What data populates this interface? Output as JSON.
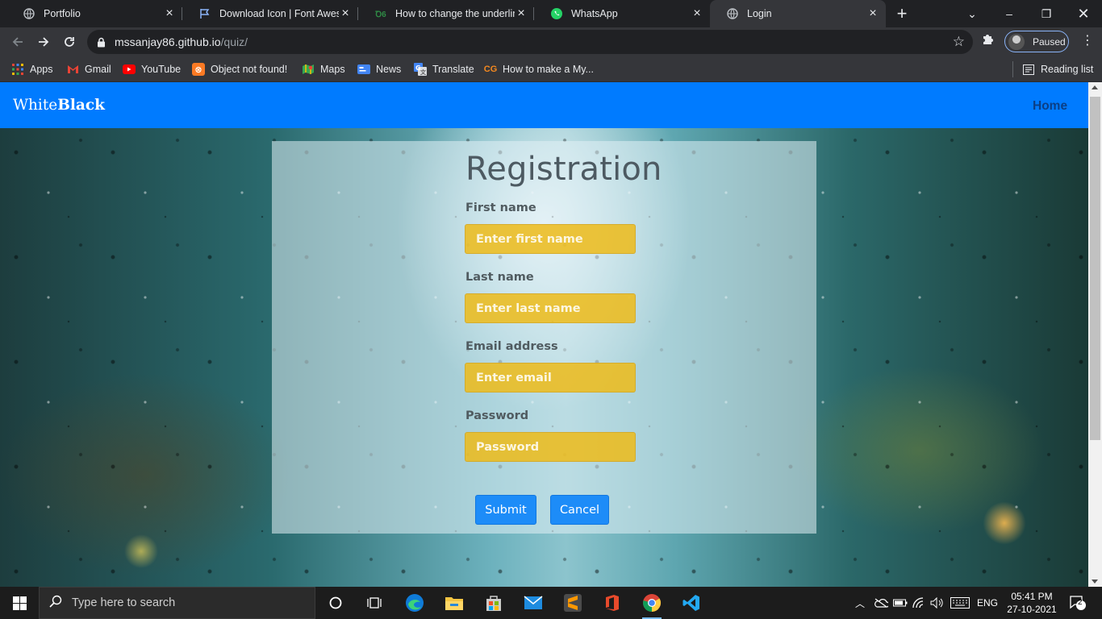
{
  "browser": {
    "tabs": [
      {
        "title": "Portfolio",
        "icon": "globe-icon"
      },
      {
        "title": "Download Icon | Font Awesome",
        "icon": "flag-icon"
      },
      {
        "title": "How to change the underline",
        "icon": "geeksforgeeks-icon"
      },
      {
        "title": "WhatsApp",
        "icon": "whatsapp-icon"
      },
      {
        "title": "Login",
        "icon": "globe-icon",
        "active": true
      }
    ],
    "url_host": "mssanjay86.github.io",
    "url_path": "/quiz/",
    "profile_label": "Paused",
    "bookmarks": [
      {
        "label": "Apps",
        "icon": "apps-grid-icon"
      },
      {
        "label": "Gmail",
        "icon": "gmail-icon"
      },
      {
        "label": "YouTube",
        "icon": "youtube-icon"
      },
      {
        "label": "Object not found!",
        "icon": "xampp-icon"
      },
      {
        "label": "Maps",
        "icon": "maps-icon"
      },
      {
        "label": "News",
        "icon": "news-icon"
      },
      {
        "label": "Translate",
        "icon": "translate-icon"
      },
      {
        "label": "How to make a My...",
        "icon": "cg-icon"
      }
    ],
    "reading_list_label": "Reading list"
  },
  "page": {
    "brand_light": "White",
    "brand_bold": "Black",
    "nav_home": "Home",
    "form": {
      "title": "Registration",
      "fields": [
        {
          "label": "First name",
          "placeholder": "Enter first name"
        },
        {
          "label": "Last name",
          "placeholder": "Enter last name"
        },
        {
          "label": "Email address",
          "placeholder": "Enter email"
        },
        {
          "label": "Password",
          "placeholder": "Password"
        }
      ],
      "submit_label": "Submit",
      "cancel_label": "Cancel"
    }
  },
  "taskbar": {
    "search_placeholder": "Type here to search",
    "language": "ENG",
    "time": "05:41 PM",
    "date": "27-10-2021",
    "notification_count": "2"
  },
  "colors": {
    "navbar": "#007bff",
    "input_fill": "#edbb19",
    "button": "#1d8cf8"
  }
}
